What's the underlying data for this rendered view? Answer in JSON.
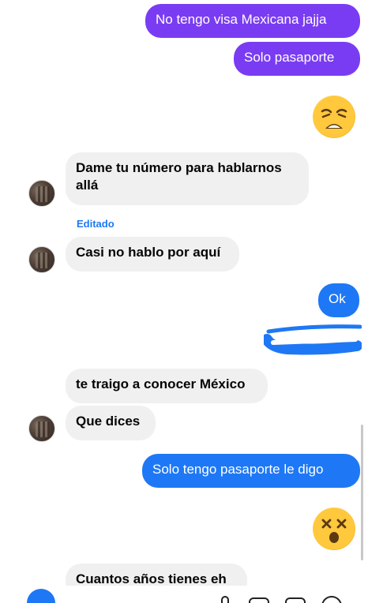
{
  "messages": {
    "m1": "No tengo visa Mexicana jajja",
    "m2": "Solo pasaporte",
    "m3": "Dame tu número para hablarnos allá",
    "edited_label": "Editado",
    "m4": "Casi no hablo por aquí",
    "m5": "Ok",
    "m6": "te traigo a conocer México",
    "m7": "Que dices",
    "m8": "Solo tengo pasaporte le digo",
    "m9": "Cuantos años tienes eh"
  },
  "colors": {
    "sent_purple": "#7a3cf2",
    "sent_blue": "#1e78f5",
    "received_gray": "#f0f0f0",
    "edited_blue": "#1e78f5"
  },
  "emojis": {
    "weary": "weary-face-emoji",
    "dizzy": "dizzy-face-emoji"
  }
}
